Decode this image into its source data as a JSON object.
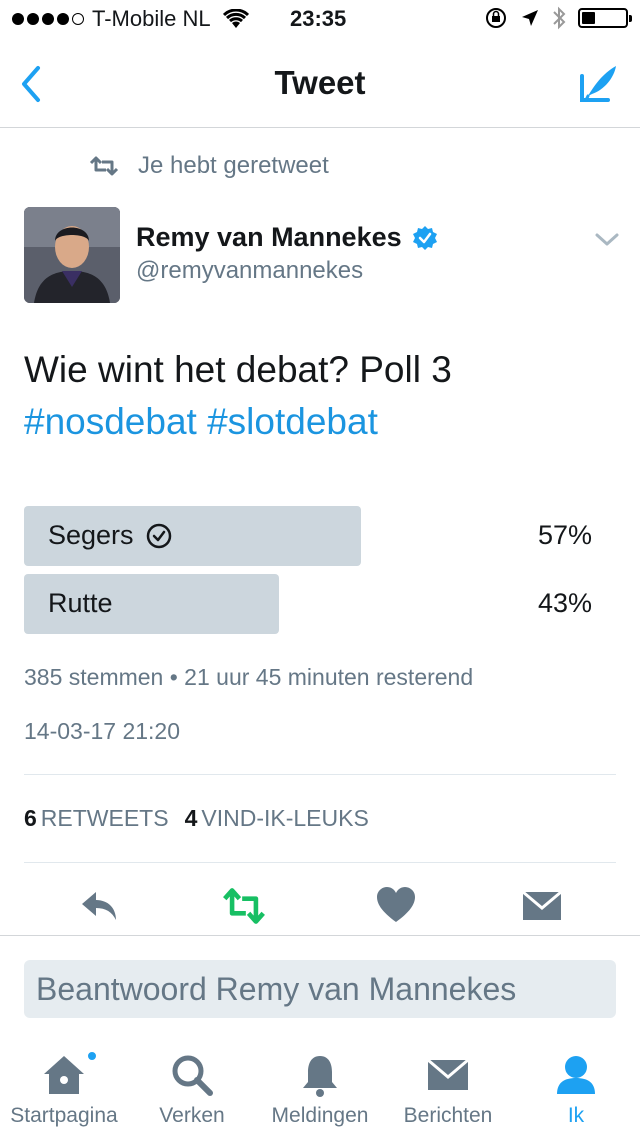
{
  "status_bar": {
    "carrier": "T-Mobile NL",
    "time": "23:35",
    "battery_level": 0.3
  },
  "nav": {
    "title": "Tweet",
    "back_icon": "chevron-left-icon",
    "compose_icon": "compose-tweet-icon"
  },
  "retweet_context": {
    "text": "Je hebt geretweet"
  },
  "author": {
    "name": "Remy van Mannekes",
    "handle": "@remyvanmannekes",
    "verified": true
  },
  "tweet": {
    "text": "Wie wint het debat? Poll 3",
    "hashtags": "#nosdebat #slotdebat"
  },
  "poll": {
    "options": [
      {
        "label": "Segers",
        "percent_label": "57%",
        "fraction": 0.57,
        "selected": true
      },
      {
        "label": "Rutte",
        "percent_label": "43%",
        "fraction": 0.43,
        "selected": false
      }
    ],
    "meta": "385 stemmen • 21 uur 45 minuten resterend"
  },
  "timestamp": "14-03-17 21:20",
  "stats": {
    "retweets_count": "6",
    "retweets_label": "RETWEETS",
    "likes_count": "4",
    "likes_label": "VIND-IK-LEUKS"
  },
  "reply": {
    "placeholder": "Beantwoord Remy van Mannekes"
  },
  "tabs": [
    {
      "label": "Startpagina",
      "icon": "home-icon",
      "active": false,
      "has_dot": true
    },
    {
      "label": "Verken",
      "icon": "search-icon",
      "active": false,
      "has_dot": false
    },
    {
      "label": "Meldingen",
      "icon": "bell-icon",
      "active": false,
      "has_dot": false
    },
    {
      "label": "Berichten",
      "icon": "envelope-icon",
      "active": false,
      "has_dot": false
    },
    {
      "label": "Ik",
      "icon": "person-icon",
      "active": true,
      "has_dot": false
    }
  ],
  "colors": {
    "accent": "#1da1f2",
    "hashtag": "#1b95e0",
    "retweet_green": "#17bf63",
    "icon_gray": "#657786",
    "poll_bar": "#ccd6dd"
  }
}
